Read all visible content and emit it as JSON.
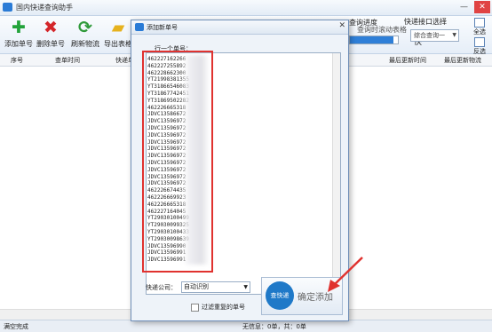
{
  "app": {
    "title": "国内快递查询助手"
  },
  "window_controls": {
    "minimize": "—",
    "close": "✕"
  },
  "toolbar": {
    "add": "添加单号",
    "delete": "删除单号",
    "refresh": "刷新物流",
    "export": "导出表格",
    "query_progress_label": "查询进度",
    "query_progress_value": 0.9,
    "auto_scroll_label": "查询时滚动表格",
    "interface_label": "快递接口选择",
    "interface_value": "综合查询一",
    "select_all": "全选",
    "invert_select": "反选",
    "query_btn_partial": "快"
  },
  "table": {
    "columns": {
      "index": "序号",
      "query_time": "查单时间",
      "express_no": "快递单号",
      "latest_time": "最后更新时间",
      "latest_logistics": "最后更新物流"
    }
  },
  "status": {
    "left": "满空完成",
    "right": "无信息：0单，共：0单"
  },
  "dialog": {
    "title": "添加新单号",
    "close": "✕",
    "input_label": "行一个单号：",
    "numbers": [
      "462227162266",
      "462227255892",
      "462228662300",
      "YT21998381355",
      "YT31866546083",
      "YT31867742451",
      "YT31869502282",
      "462226665318",
      "JDVC13586672",
      "JDVC13596972",
      "JDVC13596972",
      "JDVC13596972",
      "JDVC13596972",
      "JDVC13596972",
      "JDVC13596972",
      "JDVC13596972",
      "JDVC13596972",
      "JDVC13596972",
      "JDVC13596972",
      "462226674435",
      "462226669923",
      "462226665318",
      "462227164045",
      "YT29030100499",
      "YT29030099325",
      "YT29030100433",
      "YT29030098639",
      "JDVC13596990",
      "JDVC13596991",
      "JDVC13596991"
    ],
    "company_label": "快递公司：",
    "company_value": "自动识别",
    "filter_label": "过滤重复的单号",
    "logo_text": "查快递",
    "confirm_label": "确定添加"
  },
  "colors": {
    "accent": "#2a7bd6",
    "highlight": "#e0322f"
  }
}
